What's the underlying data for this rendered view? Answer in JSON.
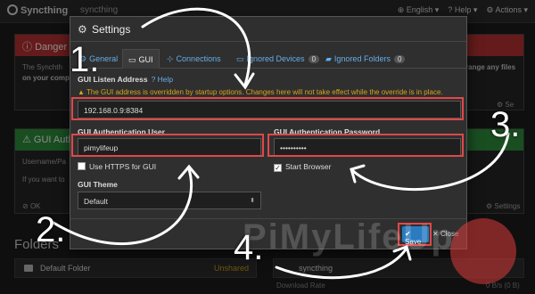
{
  "navbar": {
    "brand": "Syncthing",
    "device_name": "syncthing",
    "english": "English",
    "help": "Help",
    "actions": "Actions"
  },
  "background": {
    "danger_title": "Danger",
    "danger_text_1": "The Synchth",
    "danger_text_2": "on your comp",
    "danger_right": "range any files",
    "danger_settings": "Se",
    "gui_auth_title": "GUI Authen",
    "gui_auth_text_1": "Username/Pa",
    "gui_auth_text_2": "If you want to",
    "gui_auth_ok": "OK",
    "gui_auth_settings": "Settings",
    "folders_title": "Folders",
    "folder_name": "Default Folder",
    "folder_state": "Unshared",
    "device_name": "syncthing",
    "device_sub": "Download Rate",
    "device_rate": "0 B/s (0 B)"
  },
  "modal": {
    "title": "Settings",
    "tabs": [
      {
        "label": "General"
      },
      {
        "label": "GUI"
      },
      {
        "label": "Connections"
      },
      {
        "label": "Ignored Devices",
        "badge": "0"
      },
      {
        "label": "Ignored Folders",
        "badge": "0"
      }
    ],
    "gui_listen_label": "GUI Listen Address",
    "help_link": "Help",
    "warning": "The GUI address is overridden by startup options. Changes here will not take effect while the override is in place.",
    "listen_address": "192.168.0.9:8384",
    "auth_user_label": "GUI Authentication User",
    "auth_user_value": "pimylifeup",
    "auth_pass_label": "GUI Authentication Password",
    "auth_pass_value": "••••••••••",
    "https_label": "Use HTTPS for GUI",
    "https_checked": false,
    "start_browser_label": "Start Browser",
    "start_browser_checked": true,
    "theme_label": "GUI Theme",
    "theme_value": "Default",
    "save_label": "Save",
    "close_label": "Close"
  },
  "annotations": {
    "step1": "1.",
    "step2": "2.",
    "step3": "3.",
    "step4": "4."
  },
  "watermark": "PiMyLifeUp",
  "colors": {
    "highlight": "#e04848",
    "link": "#66aee8",
    "warning": "#d9a31c",
    "primary": "#2a7bc0",
    "danger_bg": "#b83232",
    "success_bg": "#2f8f3c"
  }
}
